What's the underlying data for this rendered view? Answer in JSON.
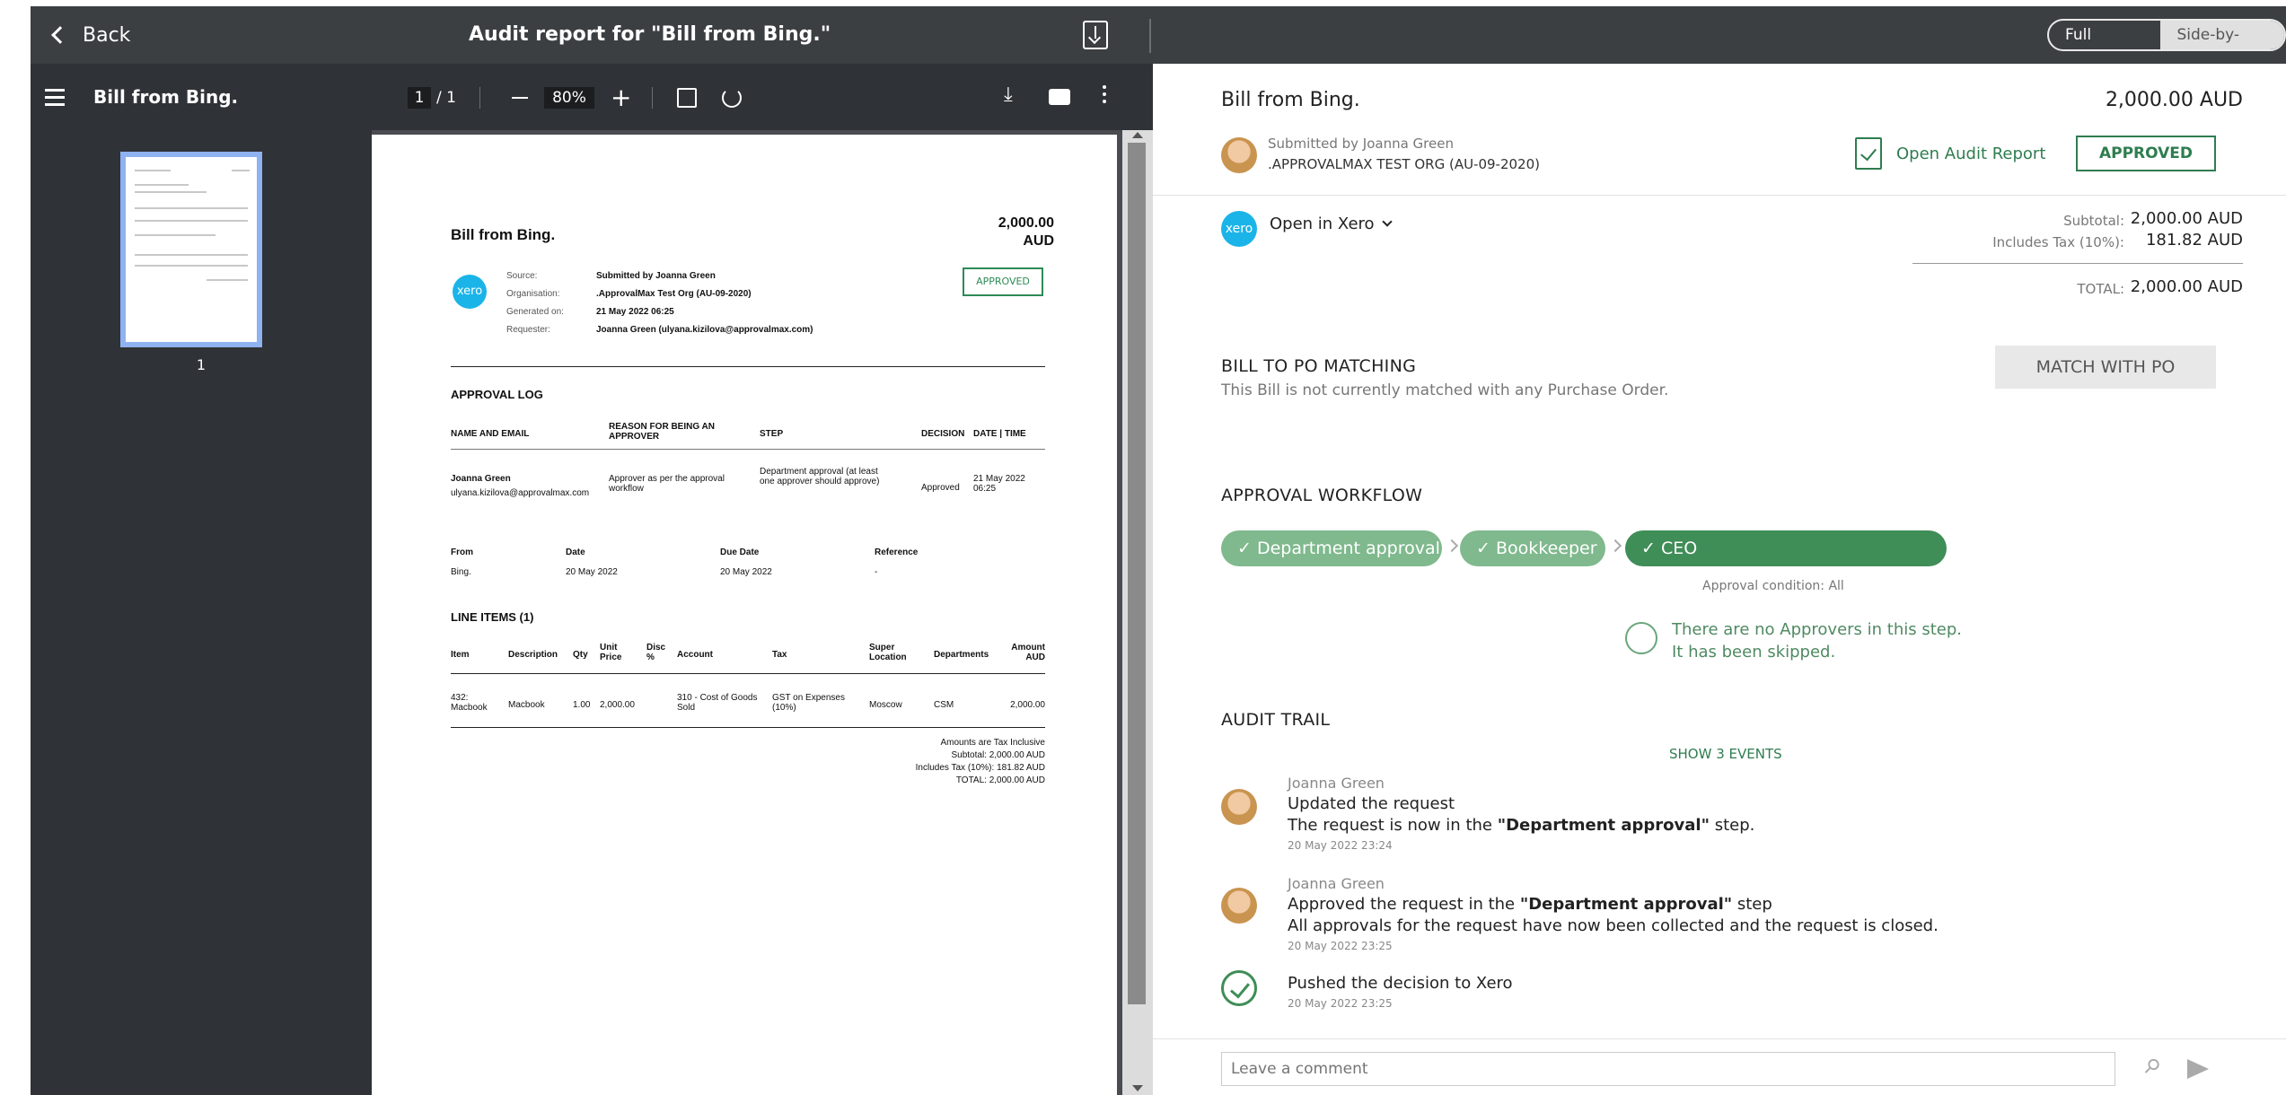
{
  "topbar": {
    "back_label": "Back",
    "title": "Audit report for \"Bill from Bing.\"",
    "view_toggle": {
      "fullscreen": "Full screen",
      "side_by_side": "Side-by-side"
    }
  },
  "viewer": {
    "doc_name": "Bill from Bing.",
    "page_current": "1",
    "page_total": "/ 1",
    "zoom": "80%",
    "thumbnail_label": "1"
  },
  "pdf": {
    "title": "Bill from Bing.",
    "amount_line1": "2,000.00",
    "amount_line2": "AUD",
    "xero_label": "xero",
    "meta_labels": [
      "Source:",
      "Organisation:",
      "Generated on:",
      "Requester:"
    ],
    "meta_values": [
      "Submitted by Joanna Green",
      ".ApprovalMax Test Org (AU-09-2020)",
      "21 May 2022 06:25",
      "Joanna Green (ulyana.kizilova@approvalmax.com)"
    ],
    "badge": "APPROVED",
    "approval_log": {
      "heading": "APPROVAL LOG",
      "headers": [
        "NAME AND EMAIL",
        "REASON FOR BEING AN APPROVER",
        "STEP",
        "DECISION",
        "DATE | TIME"
      ],
      "row": {
        "name": "Joanna Green",
        "email": "ulyana.kizilova@approvalmax.com",
        "reason": "Approver as per the approval workflow",
        "step": "Department approval (at least one approver should approve)",
        "decision": "Approved",
        "date": "21 May 2022 06:25"
      }
    },
    "info": {
      "headers": [
        "From",
        "Date",
        "Due Date",
        "Reference"
      ],
      "values": [
        "Bing.",
        "20 May 2022",
        "20 May 2022",
        "-"
      ]
    },
    "line_items": {
      "heading": "LINE ITEMS (1)",
      "headers": [
        "Item",
        "Description",
        "Qty",
        "Unit Price",
        "Disc %",
        "Account",
        "Tax",
        "Super Location",
        "Departments",
        "Amount AUD"
      ],
      "row": [
        "432: Macbook",
        "Macbook",
        "1.00",
        "2,000.00",
        "",
        "310 - Cost of Goods Sold",
        "GST on Expenses (10%)",
        "Moscow",
        "CSM",
        "2,000.00"
      ]
    },
    "summary": [
      "Amounts are Tax Inclusive",
      "Subtotal: 2,000.00 AUD",
      "Includes Tax (10%): 181.82 AUD",
      "TOTAL: 2,000.00 AUD"
    ]
  },
  "request": {
    "title": "Bill from Bing.",
    "amount": "2,000.00 AUD",
    "submitted_by": "Submitted by Joanna Green",
    "org": ".APPROVALMAX TEST ORG (AU-09-2020)",
    "open_audit": "Open Audit Report",
    "status": "APPROVED",
    "xero_label": "xero",
    "open_in_xero": "Open in Xero",
    "totals": {
      "subtotal_label": "Subtotal:",
      "subtotal": "2,000.00 AUD",
      "tax_label": "Includes Tax (10%):",
      "tax": "181.82 AUD",
      "total_label": "TOTAL:",
      "total": "2,000.00 AUD"
    }
  },
  "po_matching": {
    "heading": "BILL TO PO MATCHING",
    "note": "This Bill is not currently matched with any Purchase Order.",
    "button": "MATCH WITH PO"
  },
  "workflow": {
    "heading": "APPROVAL WORKFLOW",
    "steps": [
      "✓ Department approval",
      "✓ Bookkeeper",
      "✓ CEO"
    ],
    "condition": "Approval condition: All",
    "skip_line1": "There are no Approvers in this step.",
    "skip_line2": "It has been skipped."
  },
  "audit": {
    "heading": "AUDIT TRAIL",
    "show_events": "SHOW 3 EVENTS",
    "events": [
      {
        "user": "Joanna Green",
        "action": "Updated the request",
        "detail_prefix": "The request is now in the ",
        "detail_bold": "\"Department approval\"",
        "detail_suffix": " step.",
        "time": "20 May 2022 23:24"
      },
      {
        "user": "Joanna Green",
        "action_prefix": "Approved the request in the ",
        "action_bold": "\"Department approval\"",
        "action_suffix": " step",
        "detail": "All approvals for the request have now been collected and the request is closed.",
        "time": "20 May 2022 23:25"
      },
      {
        "action": "Pushed the decision to Xero",
        "time": "20 May 2022 23:25"
      }
    ]
  },
  "comment": {
    "placeholder": "Leave a comment"
  }
}
